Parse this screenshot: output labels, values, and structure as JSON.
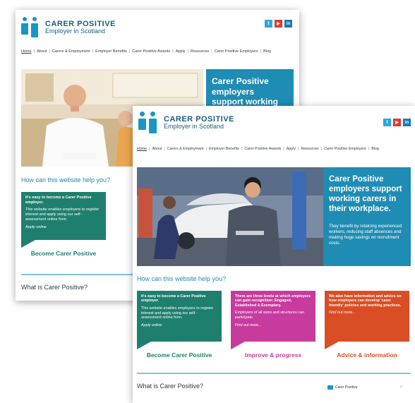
{
  "back": {
    "logo": {
      "title": "CARER POSITIVE",
      "subtitle": "Employer in Scotland"
    },
    "social": [
      "t",
      "▶",
      "in"
    ],
    "nav": [
      "Home",
      "About",
      "Carers & Employment",
      "Employer Benefits",
      "Carer Positive Awards",
      "Apply",
      "Resources",
      "Carer Positive Employers",
      "Blog"
    ],
    "hero": {
      "headline": "Carer Positive employers support working carers in"
    },
    "section_title": "How can this website help you?",
    "tile": {
      "heading": "It's easy to become a Carer Positive employer.",
      "body": "This website enables employers to register interest and apply using our self - assessment online form.",
      "link": "Apply online",
      "title": "Become Carer Positive"
    },
    "what_title": "What is Carer Positive?"
  },
  "front": {
    "logo": {
      "title": "CARER POSITIVE",
      "subtitle": "Employer in Scotland"
    },
    "social": [
      "t",
      "▶",
      "in"
    ],
    "nav": [
      "Home",
      "About",
      "Carers & Employment",
      "Employer Benefits",
      "Carer Positive Awards",
      "Apply",
      "Resources",
      "Carer Positive Employers",
      "Blog"
    ],
    "hero": {
      "headline": "Carer Positive employers support working carers in their workplace.",
      "sub": "They benefit by retaining experienced workers, reducing staff absences and making huge savings on recruitment costs."
    },
    "section_title": "How can this website help you?",
    "tiles": [
      {
        "heading": "It's easy to become a Carer Positive employer.",
        "body": "This website enables employers to register interest and apply using our self - assessment online form.",
        "link": "Apply online",
        "title": "Become Carer Positive",
        "color": "#1f7f6e",
        "title_color": "#1f7f6e"
      },
      {
        "heading": "There are three levels at which employers can gain recognition: Engaged, Established & Exemplary.",
        "body": "Employers of all sizes and structures can participate.",
        "link": "Find out more...",
        "title": "Improve & progress",
        "color": "#c63b9d",
        "title_color": "#c63b9d"
      },
      {
        "heading": "We also have information and advice on how employers can develop 'carer friendly' policies and working practices.",
        "body": "",
        "link": "Find out more...",
        "title": "Advice & information",
        "color": "#d94e24",
        "title_color": "#d94e24"
      }
    ],
    "what_title": "What is Carer Positive?",
    "mini_logo": "Carer Positive"
  }
}
